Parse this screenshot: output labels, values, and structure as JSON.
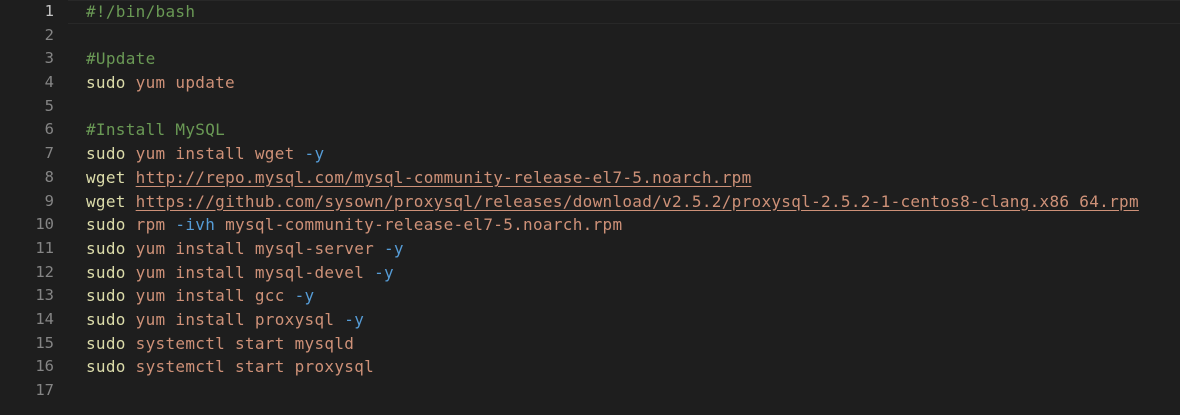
{
  "editor": {
    "lines": [
      {
        "number": "1",
        "tokens": [
          {
            "cls": "cmt",
            "text": "#!/bin/bash"
          }
        ]
      },
      {
        "number": "2",
        "tokens": []
      },
      {
        "number": "3",
        "tokens": [
          {
            "cls": "cmt",
            "text": "#Update"
          }
        ]
      },
      {
        "number": "4",
        "tokens": [
          {
            "cls": "cmd",
            "text": "sudo"
          },
          {
            "cls": "arg",
            "text": " yum update"
          }
        ]
      },
      {
        "number": "5",
        "tokens": []
      },
      {
        "number": "6",
        "tokens": [
          {
            "cls": "cmt",
            "text": "#Install MySQL"
          }
        ]
      },
      {
        "number": "7",
        "tokens": [
          {
            "cls": "cmd",
            "text": "sudo"
          },
          {
            "cls": "arg",
            "text": " yum install wget "
          },
          {
            "cls": "opt",
            "text": "-y"
          }
        ]
      },
      {
        "number": "8",
        "tokens": [
          {
            "cls": "cmd",
            "text": "wget"
          },
          {
            "cls": "arg",
            "text": " "
          },
          {
            "cls": "url",
            "text": "http://repo.mysql.com/mysql-community-release-el7-5.noarch.rpm"
          }
        ]
      },
      {
        "number": "9",
        "tokens": [
          {
            "cls": "cmd",
            "text": "wget"
          },
          {
            "cls": "arg",
            "text": " "
          },
          {
            "cls": "url",
            "text": "https://github.com/sysown/proxysql/releases/download/v2.5.2/proxysql-2.5.2-1-centos8-clang.x86_64.rpm"
          }
        ]
      },
      {
        "number": "10",
        "tokens": [
          {
            "cls": "cmd",
            "text": "sudo"
          },
          {
            "cls": "arg",
            "text": " rpm "
          },
          {
            "cls": "opt",
            "text": "-ivh"
          },
          {
            "cls": "arg",
            "text": " mysql-community-release-el7-5.noarch.rpm"
          }
        ]
      },
      {
        "number": "11",
        "tokens": [
          {
            "cls": "cmd",
            "text": "sudo"
          },
          {
            "cls": "arg",
            "text": " yum install mysql-server "
          },
          {
            "cls": "opt",
            "text": "-y"
          }
        ]
      },
      {
        "number": "12",
        "tokens": [
          {
            "cls": "cmd",
            "text": "sudo"
          },
          {
            "cls": "arg",
            "text": " yum install mysql-devel "
          },
          {
            "cls": "opt",
            "text": "-y"
          }
        ]
      },
      {
        "number": "13",
        "tokens": [
          {
            "cls": "cmd",
            "text": "sudo"
          },
          {
            "cls": "arg",
            "text": " yum install gcc "
          },
          {
            "cls": "opt",
            "text": "-y"
          }
        ]
      },
      {
        "number": "14",
        "tokens": [
          {
            "cls": "cmd",
            "text": "sudo"
          },
          {
            "cls": "arg",
            "text": " yum install proxysql "
          },
          {
            "cls": "opt",
            "text": "-y"
          }
        ]
      },
      {
        "number": "15",
        "tokens": [
          {
            "cls": "cmd",
            "text": "sudo"
          },
          {
            "cls": "arg",
            "text": " systemctl start mysqld"
          }
        ]
      },
      {
        "number": "16",
        "tokens": [
          {
            "cls": "cmd",
            "text": "sudo"
          },
          {
            "cls": "arg",
            "text": " systemctl start proxysql"
          }
        ]
      },
      {
        "number": "17",
        "tokens": []
      }
    ],
    "active_line": "1",
    "colors": {
      "background": "#1e1e1e",
      "comment": "#6a9955",
      "command": "#dcdcaa",
      "string": "#ce9178",
      "option": "#569cd6",
      "line_number": "#858585"
    }
  }
}
